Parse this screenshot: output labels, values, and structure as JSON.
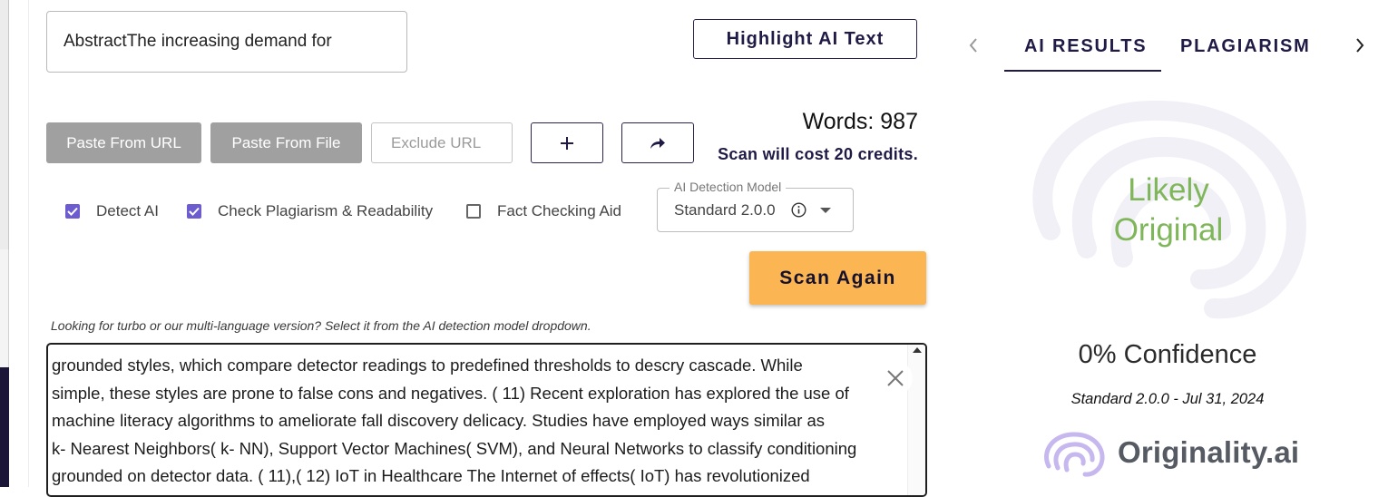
{
  "input": {
    "title_value": "AbstractThe increasing demand for"
  },
  "toolbar": {
    "highlight_label": "Highlight AI Text",
    "paste_url_label": "Paste From URL",
    "paste_file_label": "Paste From File",
    "exclude_url_placeholder": "Exclude URL",
    "add_icon": "plus-icon",
    "share_icon": "share-arrow-icon"
  },
  "stats": {
    "words": "Words: 987",
    "cost": "Scan will cost 20 credits."
  },
  "options": {
    "detect_ai": {
      "label": "Detect AI",
      "checked": true
    },
    "check_plagiarism": {
      "label": "Check Plagiarism & Readability",
      "checked": true
    },
    "fact_checking": {
      "label": "Fact Checking Aid",
      "checked": false
    }
  },
  "model_select": {
    "legend": "AI Detection Model",
    "value": "Standard 2.0.0"
  },
  "scan_label": "Scan Again",
  "hint": "Looking for turbo or our multi-language version? Select it from the AI detection model dropdown.",
  "editor": {
    "lines": [
      "grounded  styles, which compare detector readings to predefined thresholds to  descry cascade. While",
      "simple, these  styles are prone to false cons and negatives. ( 11) Recent  exploration has explored the use of",
      "machine  literacy algorithms to ameliorate fall discovery  delicacy. Studies have employed  ways  similar as",
      "k- Nearest Neighbors( k- NN), Support Vector Machines( SVM), and Neural Networks to classify conditioning",
      "grounded on detector data. ( 11),( 12)  IoT in Healthcare  The Internet of effects( IoT) has revolutionized"
    ]
  },
  "results": {
    "tabs": [
      "AI RESULTS",
      "PLAGIARISM"
    ],
    "active_tab": "AI RESULTS",
    "verdict_line1": "Likely",
    "verdict_line2": "Original",
    "confidence": "0% Confidence",
    "model_date": "Standard 2.0.0 - Jul 31, 2024",
    "brand": "Originality.ai"
  },
  "colors": {
    "accent": "#6d5bd0",
    "navy": "#1f1a46",
    "scan_button": "#fbb552",
    "verdict_green": "#7fb65a",
    "grey_button": "#a0a0a0"
  }
}
